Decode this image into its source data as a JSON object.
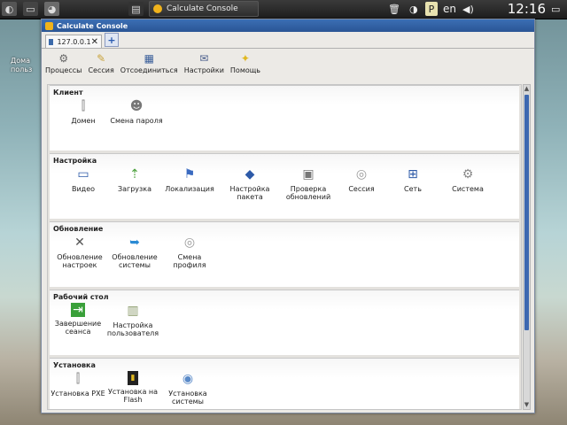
{
  "taskbar": {
    "task_title": "Calculate Console",
    "lang": "en",
    "clock": "12:16"
  },
  "desktop": {
    "icon_label_1": "Дома",
    "icon_label_2": "польз"
  },
  "window": {
    "title": "Calculate Console",
    "tab_label": "127.0.0.1",
    "tab_close": "✕",
    "add_tab": "+"
  },
  "toolbar": {
    "items": [
      {
        "label": "Процессы",
        "icon": "gears-icon"
      },
      {
        "label": "Сессия",
        "icon": "session-icon"
      },
      {
        "label": "Отсоединиться",
        "icon": "disconnect-icon"
      },
      {
        "label": "Настройки",
        "icon": "settings-icon"
      },
      {
        "label": "Помощь",
        "icon": "help-icon"
      }
    ]
  },
  "groups": [
    {
      "title": "Клиент",
      "items": [
        {
          "line1": "Домен",
          "line2": ""
        },
        {
          "line1": "Смена пароля",
          "line2": ""
        }
      ]
    },
    {
      "title": "Настройка",
      "items": [
        {
          "line1": "Видео",
          "line2": ""
        },
        {
          "line1": "Загрузка",
          "line2": ""
        },
        {
          "line1": "Локализация",
          "line2": ""
        },
        {
          "line1": "Настройка",
          "line2": "пакета"
        },
        {
          "line1": "Проверка",
          "line2": "обновлений"
        },
        {
          "line1": "Сессия",
          "line2": ""
        },
        {
          "line1": "Сеть",
          "line2": ""
        },
        {
          "line1": "Система",
          "line2": ""
        }
      ]
    },
    {
      "title": "Обновление",
      "items": [
        {
          "line1": "Обновление",
          "line2": "настроек"
        },
        {
          "line1": "Обновление",
          "line2": "системы"
        },
        {
          "line1": "Смена",
          "line2": "профиля"
        }
      ]
    },
    {
      "title": "Рабочий стол",
      "items": [
        {
          "line1": "Завершение",
          "line2": "сеанса"
        },
        {
          "line1": "Настройка",
          "line2": "пользователя"
        }
      ]
    },
    {
      "title": "Установка",
      "items": [
        {
          "line1": "Установка PXE",
          "line2": ""
        },
        {
          "line1": "Установка на",
          "line2": "Flash"
        },
        {
          "line1": "Установка",
          "line2": "системы"
        }
      ]
    }
  ]
}
